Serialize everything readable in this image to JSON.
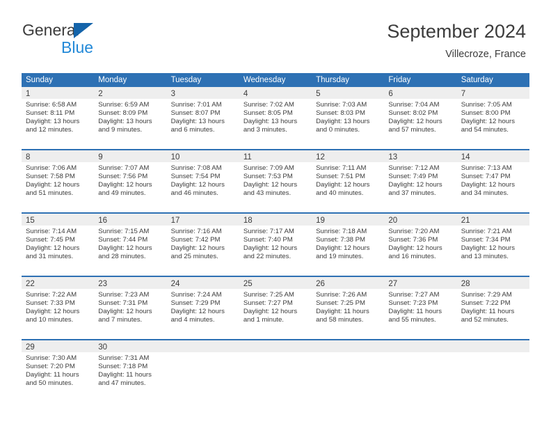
{
  "brand": {
    "name_part1": "General",
    "name_part2": "Blue",
    "triangle_icon": "brand-triangle-icon",
    "colors": {
      "general_text": "#3c3c3c",
      "blue_text": "#2389d8",
      "triangle": "#1464aa"
    }
  },
  "header": {
    "month_title": "September 2024",
    "location": "Villecroze, France"
  },
  "theme": {
    "header_row_bg": "#2e71b4",
    "header_row_text": "#ffffff",
    "date_band_bg": "#eeeeee",
    "cell_bg": "#ffffff",
    "week_separator": "#2e71b4",
    "body_text": "#3c3c3c"
  },
  "calendar": {
    "day_headers": [
      "Sunday",
      "Monday",
      "Tuesday",
      "Wednesday",
      "Thursday",
      "Friday",
      "Saturday"
    ],
    "weeks": [
      [
        {
          "day": "1",
          "sunrise": "Sunrise: 6:58 AM",
          "sunset": "Sunset: 8:11 PM",
          "daylight_line1": "Daylight: 13 hours",
          "daylight_line2": "and 12 minutes."
        },
        {
          "day": "2",
          "sunrise": "Sunrise: 6:59 AM",
          "sunset": "Sunset: 8:09 PM",
          "daylight_line1": "Daylight: 13 hours",
          "daylight_line2": "and 9 minutes."
        },
        {
          "day": "3",
          "sunrise": "Sunrise: 7:01 AM",
          "sunset": "Sunset: 8:07 PM",
          "daylight_line1": "Daylight: 13 hours",
          "daylight_line2": "and 6 minutes."
        },
        {
          "day": "4",
          "sunrise": "Sunrise: 7:02 AM",
          "sunset": "Sunset: 8:05 PM",
          "daylight_line1": "Daylight: 13 hours",
          "daylight_line2": "and 3 minutes."
        },
        {
          "day": "5",
          "sunrise": "Sunrise: 7:03 AM",
          "sunset": "Sunset: 8:03 PM",
          "daylight_line1": "Daylight: 13 hours",
          "daylight_line2": "and 0 minutes."
        },
        {
          "day": "6",
          "sunrise": "Sunrise: 7:04 AM",
          "sunset": "Sunset: 8:02 PM",
          "daylight_line1": "Daylight: 12 hours",
          "daylight_line2": "and 57 minutes."
        },
        {
          "day": "7",
          "sunrise": "Sunrise: 7:05 AM",
          "sunset": "Sunset: 8:00 PM",
          "daylight_line1": "Daylight: 12 hours",
          "daylight_line2": "and 54 minutes."
        }
      ],
      [
        {
          "day": "8",
          "sunrise": "Sunrise: 7:06 AM",
          "sunset": "Sunset: 7:58 PM",
          "daylight_line1": "Daylight: 12 hours",
          "daylight_line2": "and 51 minutes."
        },
        {
          "day": "9",
          "sunrise": "Sunrise: 7:07 AM",
          "sunset": "Sunset: 7:56 PM",
          "daylight_line1": "Daylight: 12 hours",
          "daylight_line2": "and 49 minutes."
        },
        {
          "day": "10",
          "sunrise": "Sunrise: 7:08 AM",
          "sunset": "Sunset: 7:54 PM",
          "daylight_line1": "Daylight: 12 hours",
          "daylight_line2": "and 46 minutes."
        },
        {
          "day": "11",
          "sunrise": "Sunrise: 7:09 AM",
          "sunset": "Sunset: 7:53 PM",
          "daylight_line1": "Daylight: 12 hours",
          "daylight_line2": "and 43 minutes."
        },
        {
          "day": "12",
          "sunrise": "Sunrise: 7:11 AM",
          "sunset": "Sunset: 7:51 PM",
          "daylight_line1": "Daylight: 12 hours",
          "daylight_line2": "and 40 minutes."
        },
        {
          "day": "13",
          "sunrise": "Sunrise: 7:12 AM",
          "sunset": "Sunset: 7:49 PM",
          "daylight_line1": "Daylight: 12 hours",
          "daylight_line2": "and 37 minutes."
        },
        {
          "day": "14",
          "sunrise": "Sunrise: 7:13 AM",
          "sunset": "Sunset: 7:47 PM",
          "daylight_line1": "Daylight: 12 hours",
          "daylight_line2": "and 34 minutes."
        }
      ],
      [
        {
          "day": "15",
          "sunrise": "Sunrise: 7:14 AM",
          "sunset": "Sunset: 7:45 PM",
          "daylight_line1": "Daylight: 12 hours",
          "daylight_line2": "and 31 minutes."
        },
        {
          "day": "16",
          "sunrise": "Sunrise: 7:15 AM",
          "sunset": "Sunset: 7:44 PM",
          "daylight_line1": "Daylight: 12 hours",
          "daylight_line2": "and 28 minutes."
        },
        {
          "day": "17",
          "sunrise": "Sunrise: 7:16 AM",
          "sunset": "Sunset: 7:42 PM",
          "daylight_line1": "Daylight: 12 hours",
          "daylight_line2": "and 25 minutes."
        },
        {
          "day": "18",
          "sunrise": "Sunrise: 7:17 AM",
          "sunset": "Sunset: 7:40 PM",
          "daylight_line1": "Daylight: 12 hours",
          "daylight_line2": "and 22 minutes."
        },
        {
          "day": "19",
          "sunrise": "Sunrise: 7:18 AM",
          "sunset": "Sunset: 7:38 PM",
          "daylight_line1": "Daylight: 12 hours",
          "daylight_line2": "and 19 minutes."
        },
        {
          "day": "20",
          "sunrise": "Sunrise: 7:20 AM",
          "sunset": "Sunset: 7:36 PM",
          "daylight_line1": "Daylight: 12 hours",
          "daylight_line2": "and 16 minutes."
        },
        {
          "day": "21",
          "sunrise": "Sunrise: 7:21 AM",
          "sunset": "Sunset: 7:34 PM",
          "daylight_line1": "Daylight: 12 hours",
          "daylight_line2": "and 13 minutes."
        }
      ],
      [
        {
          "day": "22",
          "sunrise": "Sunrise: 7:22 AM",
          "sunset": "Sunset: 7:33 PM",
          "daylight_line1": "Daylight: 12 hours",
          "daylight_line2": "and 10 minutes."
        },
        {
          "day": "23",
          "sunrise": "Sunrise: 7:23 AM",
          "sunset": "Sunset: 7:31 PM",
          "daylight_line1": "Daylight: 12 hours",
          "daylight_line2": "and 7 minutes."
        },
        {
          "day": "24",
          "sunrise": "Sunrise: 7:24 AM",
          "sunset": "Sunset: 7:29 PM",
          "daylight_line1": "Daylight: 12 hours",
          "daylight_line2": "and 4 minutes."
        },
        {
          "day": "25",
          "sunrise": "Sunrise: 7:25 AM",
          "sunset": "Sunset: 7:27 PM",
          "daylight_line1": "Daylight: 12 hours",
          "daylight_line2": "and 1 minute."
        },
        {
          "day": "26",
          "sunrise": "Sunrise: 7:26 AM",
          "sunset": "Sunset: 7:25 PM",
          "daylight_line1": "Daylight: 11 hours",
          "daylight_line2": "and 58 minutes."
        },
        {
          "day": "27",
          "sunrise": "Sunrise: 7:27 AM",
          "sunset": "Sunset: 7:23 PM",
          "daylight_line1": "Daylight: 11 hours",
          "daylight_line2": "and 55 minutes."
        },
        {
          "day": "28",
          "sunrise": "Sunrise: 7:29 AM",
          "sunset": "Sunset: 7:22 PM",
          "daylight_line1": "Daylight: 11 hours",
          "daylight_line2": "and 52 minutes."
        }
      ],
      [
        {
          "day": "29",
          "sunrise": "Sunrise: 7:30 AM",
          "sunset": "Sunset: 7:20 PM",
          "daylight_line1": "Daylight: 11 hours",
          "daylight_line2": "and 50 minutes."
        },
        {
          "day": "30",
          "sunrise": "Sunrise: 7:31 AM",
          "sunset": "Sunset: 7:18 PM",
          "daylight_line1": "Daylight: 11 hours",
          "daylight_line2": "and 47 minutes."
        },
        {
          "day": "",
          "sunrise": "",
          "sunset": "",
          "daylight_line1": "",
          "daylight_line2": ""
        },
        {
          "day": "",
          "sunrise": "",
          "sunset": "",
          "daylight_line1": "",
          "daylight_line2": ""
        },
        {
          "day": "",
          "sunrise": "",
          "sunset": "",
          "daylight_line1": "",
          "daylight_line2": ""
        },
        {
          "day": "",
          "sunrise": "",
          "sunset": "",
          "daylight_line1": "",
          "daylight_line2": ""
        },
        {
          "day": "",
          "sunrise": "",
          "sunset": "",
          "daylight_line1": "",
          "daylight_line2": ""
        }
      ]
    ]
  }
}
